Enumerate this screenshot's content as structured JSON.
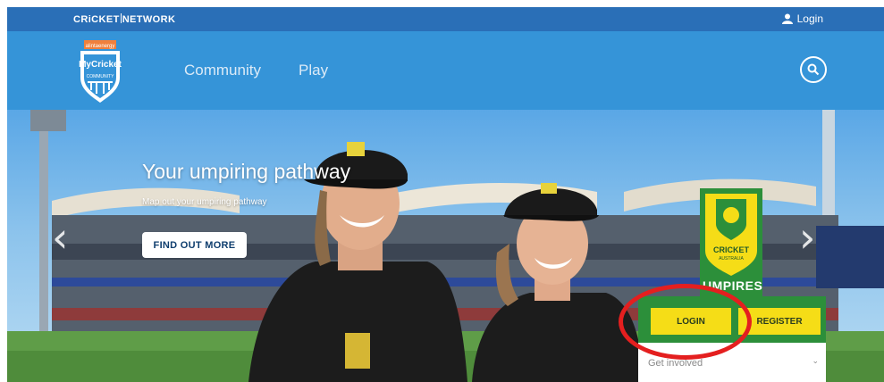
{
  "topbar": {
    "brand_left": "CRiCKET",
    "brand_right": "NETWORK",
    "login_label": "Login"
  },
  "nav": {
    "logo": {
      "sponsor": "alintaenergy",
      "title": "MyCricket",
      "subtitle": "COMMUNITY"
    },
    "links": [
      {
        "label": "Community"
      },
      {
        "label": "Play"
      }
    ]
  },
  "hero": {
    "title": "Your umpiring pathway",
    "subtitle": "Map out your umpiring pathway",
    "cta_label": "FIND OUT MORE"
  },
  "badge": {
    "line1": "CRICKET",
    "line2": "AUSTRALIA",
    "umpires": "UMPIRES"
  },
  "panel": {
    "login_label": "LOGIN",
    "register_label": "REGISTER",
    "dropdown_value": "Get involved"
  },
  "colors": {
    "topbar": "#2a6fb7",
    "navbar": "#3594d8",
    "panel_green": "#2c8f3a",
    "button_yellow": "#f5dd17",
    "highlight_red": "#e41f1f"
  },
  "icons": [
    "user-icon",
    "search-icon",
    "chevron-left-icon",
    "chevron-right-icon",
    "chevron-down-icon"
  ]
}
